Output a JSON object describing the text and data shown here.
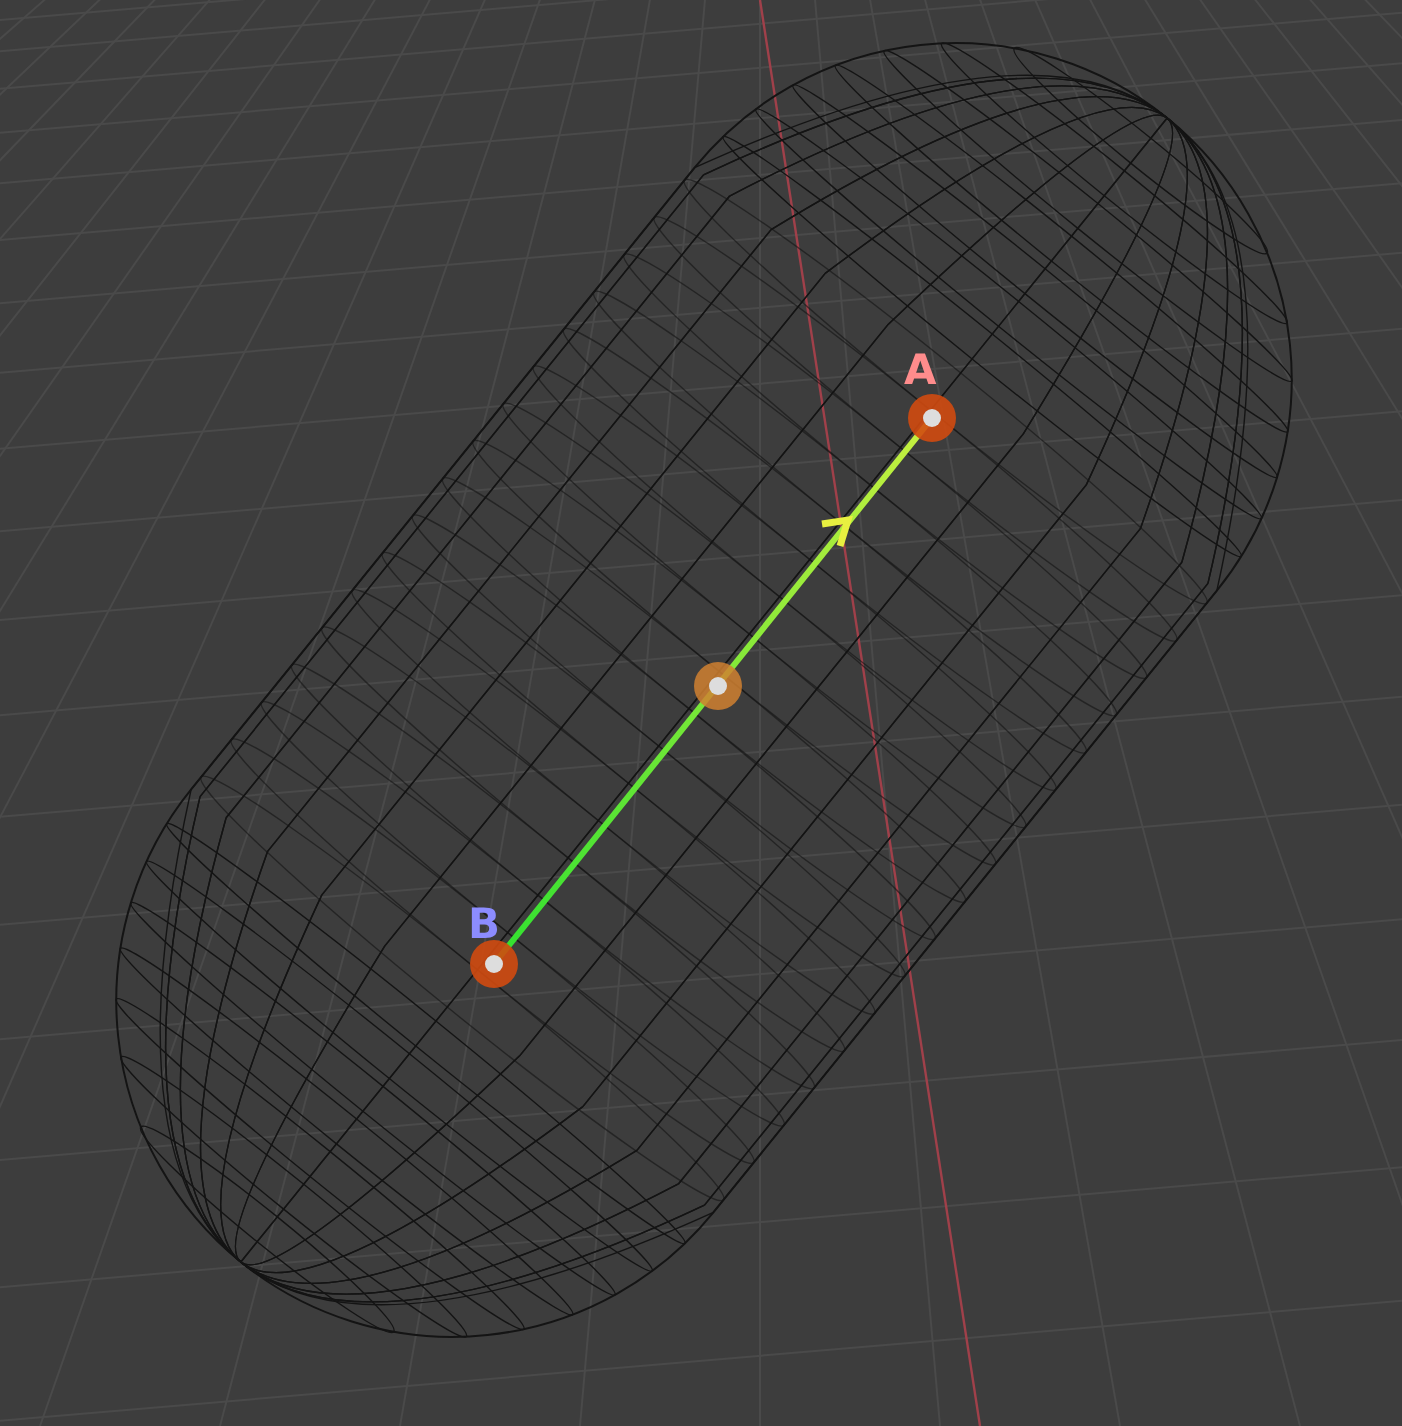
{
  "viewport": {
    "points": [
      {
        "label": "A",
        "color": "#ff8c8c"
      },
      {
        "label": "B",
        "color": "#8c8cff"
      }
    ]
  }
}
